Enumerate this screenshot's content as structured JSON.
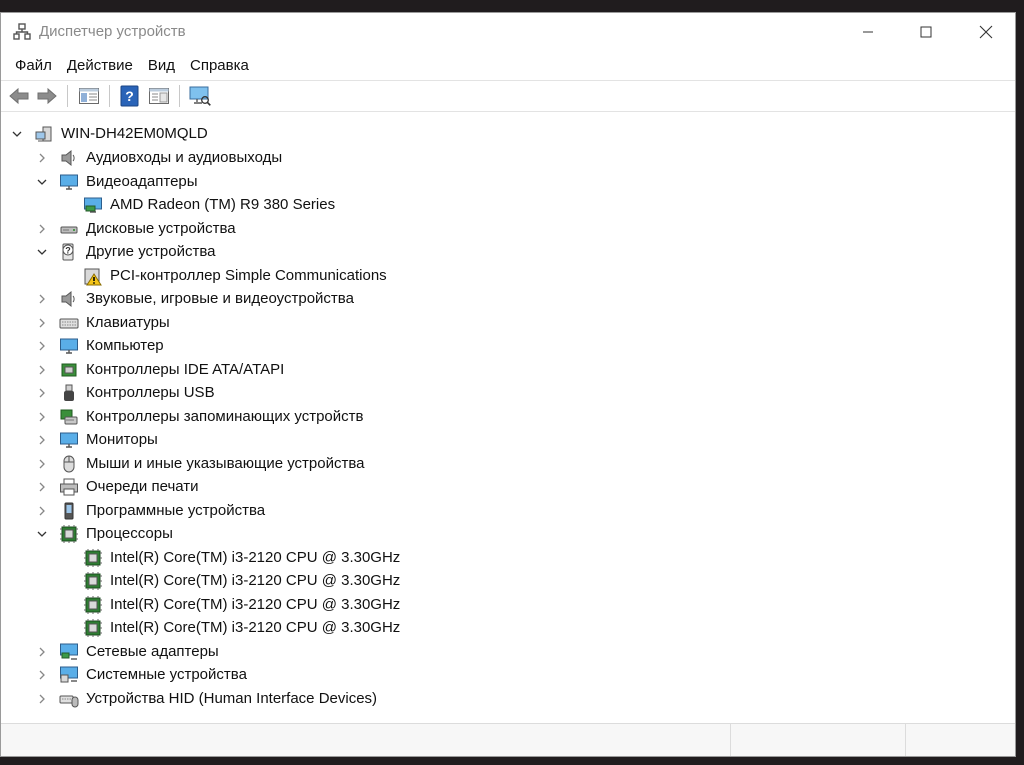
{
  "window": {
    "title": "Диспетчер устройств"
  },
  "menu": [
    "Файл",
    "Действие",
    "Вид",
    "Справка"
  ],
  "toolbar": {
    "buttons": [
      "back",
      "forward",
      "properties-pane",
      "help",
      "view-properties",
      "scan-monitor"
    ]
  },
  "tree": {
    "root": "WIN-DH42EM0MQLD",
    "rows": [
      {
        "label": "Аудиовходы и аудиовыходы",
        "icon": "speaker",
        "expanded": false
      },
      {
        "label": "Видеоадаптеры",
        "icon": "monitor",
        "expanded": true
      },
      {
        "label": "AMD Radeon (TM) R9 380 Series",
        "icon": "display-adapter",
        "child": true
      },
      {
        "label": "Дисковые устройства",
        "icon": "disk",
        "expanded": false
      },
      {
        "label": "Другие устройства",
        "icon": "unknown-device",
        "expanded": true
      },
      {
        "label": "PCI-контроллер Simple Communications",
        "icon": "warning-device",
        "child": true
      },
      {
        "label": "Звуковые, игровые и видеоустройства",
        "icon": "speaker",
        "expanded": false
      },
      {
        "label": "Клавиатуры",
        "icon": "keyboard",
        "expanded": false
      },
      {
        "label": "Компьютер",
        "icon": "monitor",
        "expanded": false
      },
      {
        "label": "Контроллеры IDE ATA/ATAPI",
        "icon": "ide-controller",
        "expanded": false
      },
      {
        "label": "Контроллеры USB",
        "icon": "usb",
        "expanded": false
      },
      {
        "label": "Контроллеры запоминающих устройств",
        "icon": "storage-controller",
        "expanded": false
      },
      {
        "label": "Мониторы",
        "icon": "monitor",
        "expanded": false
      },
      {
        "label": "Мыши и иные указывающие устройства",
        "icon": "mouse",
        "expanded": false
      },
      {
        "label": "Очереди печати",
        "icon": "printer",
        "expanded": false
      },
      {
        "label": "Программные устройства",
        "icon": "software-device",
        "expanded": false
      },
      {
        "label": "Процессоры",
        "icon": "cpu",
        "expanded": true
      },
      {
        "label": "Intel(R) Core(TM) i3-2120 CPU @ 3.30GHz",
        "icon": "cpu",
        "child": true
      },
      {
        "label": "Intel(R) Core(TM) i3-2120 CPU @ 3.30GHz",
        "icon": "cpu",
        "child": true
      },
      {
        "label": "Intel(R) Core(TM) i3-2120 CPU @ 3.30GHz",
        "icon": "cpu",
        "child": true
      },
      {
        "label": "Intel(R) Core(TM) i3-2120 CPU @ 3.30GHz",
        "icon": "cpu",
        "child": true
      },
      {
        "label": "Сетевые адаптеры",
        "icon": "network",
        "expanded": false
      },
      {
        "label": "Системные устройства",
        "icon": "system",
        "expanded": false
      },
      {
        "label": "Устройства HID (Human Interface Devices)",
        "icon": "hid",
        "expanded": false
      }
    ]
  },
  "colors": {
    "accent": "#2f7fd0",
    "window_bg": "#ffffff",
    "desktop": "#201c1e"
  }
}
